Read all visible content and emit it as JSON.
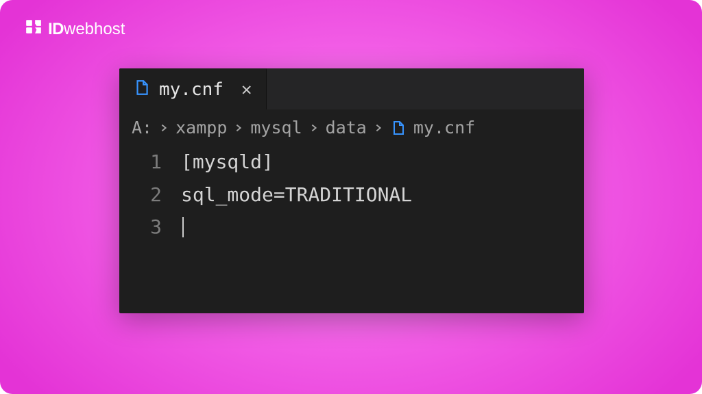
{
  "brand": {
    "id": "ID",
    "rest": "webhost"
  },
  "tab": {
    "filename": "my.cnf",
    "close_glyph": "✕"
  },
  "breadcrumbs": {
    "drive": "A:",
    "parts": [
      "xampp",
      "mysql",
      "data"
    ],
    "filename": "my.cnf"
  },
  "code": {
    "lines": [
      {
        "n": "1",
        "t": "[mysqld]"
      },
      {
        "n": "2",
        "t": "sql_mode=TRADITIONAL"
      },
      {
        "n": "3",
        "t": ""
      }
    ]
  },
  "colors": {
    "file_icon": "#3794ff",
    "editor_bg": "#1e1e1e",
    "tab_bg": "#252526",
    "text": "#d4d4d4"
  }
}
